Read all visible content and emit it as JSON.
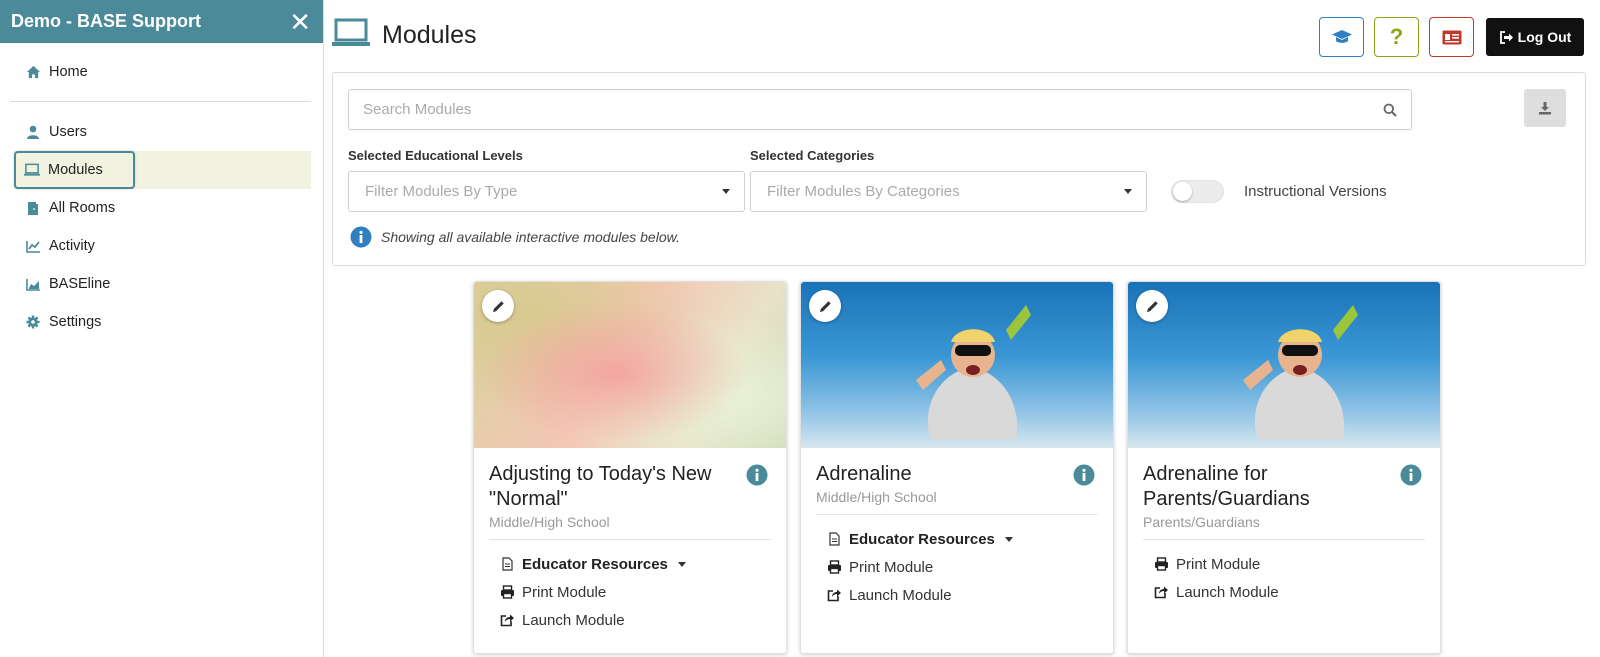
{
  "sidebar": {
    "title": "Demo - BASE Support",
    "items": [
      {
        "label": "Home",
        "icon": "home-icon"
      },
      {
        "label": "Users",
        "icon": "user-icon"
      },
      {
        "label": "Modules",
        "icon": "laptop-icon"
      },
      {
        "label": "All Rooms",
        "icon": "door-icon"
      },
      {
        "label": "Activity",
        "icon": "line-chart-icon"
      },
      {
        "label": "BASEline",
        "icon": "bar-chart-icon"
      },
      {
        "label": "Settings",
        "icon": "gear-icon"
      }
    ]
  },
  "header": {
    "title": "Modules",
    "logout_label": "Log Out",
    "help_glyph": "?"
  },
  "filters": {
    "search_placeholder": "Search Modules",
    "edu_label": "Selected Educational Levels",
    "edu_placeholder": "Filter Modules By Type",
    "cat_label": "Selected Categories",
    "cat_placeholder": "Filter Modules By Categories",
    "toggle_label": "Instructional Versions",
    "toggle_on": false,
    "info_text": "Showing all available interactive modules below."
  },
  "modules": [
    {
      "title": "Adjusting to Today's New \"Normal\"",
      "subtitle": "Middle/High School",
      "educator_resources": "Educator Resources",
      "print": "Print Module",
      "launch": "Launch Module"
    },
    {
      "title": "Adrenaline",
      "subtitle": "Middle/High School",
      "educator_resources": "Educator Resources",
      "print": "Print Module",
      "launch": "Launch Module"
    },
    {
      "title": "Adrenaline for Parents/Guardians",
      "subtitle": "Parents/Guardians",
      "print": "Print Module",
      "launch": "Launch Module"
    }
  ],
  "colors": {
    "brand": "#4a8a99",
    "active_bg": "#f1f3e0",
    "info_blue": "#2f7fc1"
  }
}
